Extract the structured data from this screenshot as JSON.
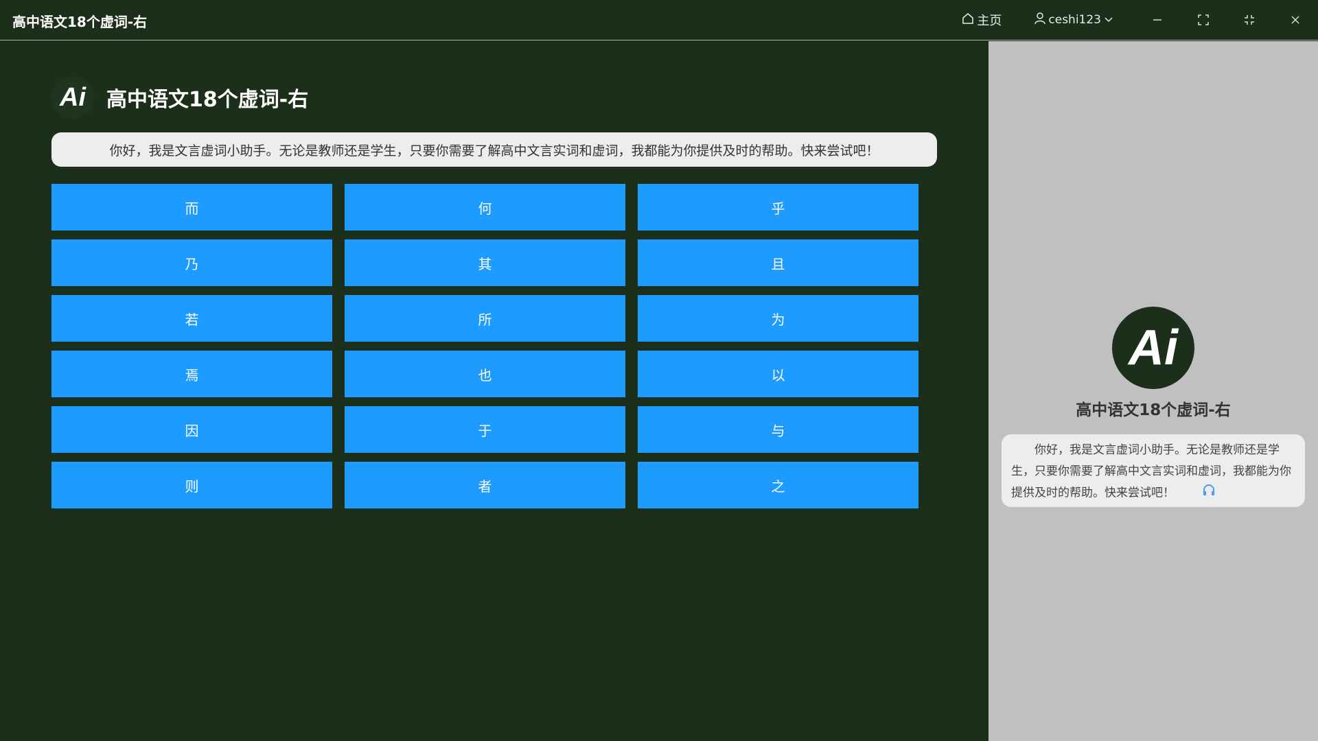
{
  "window": {
    "title": "高中语文18个虚词-右",
    "home_label": "主页",
    "user_label": "ceshi123"
  },
  "main": {
    "logo_text": "Ai",
    "title": "高中语文18个虚词-右",
    "intro": "你好，我是文言虚词小助手。无论是教师还是学生，只要你需要了解高中文言实词和虚词，我都能为你提供及时的帮助。快来尝试吧！",
    "words": [
      "而",
      "何",
      "乎",
      "乃",
      "其",
      "且",
      "若",
      "所",
      "为",
      "焉",
      "也",
      "以",
      "因",
      "于",
      "与",
      "则",
      "者",
      "之"
    ]
  },
  "side": {
    "logo_text": "Ai",
    "title": "高中语文18个虚词-右",
    "message": "你好，我是文言虚词小助手。无论是教师还是学生，只要你需要了解高中文言实词和虚词，我都能为你提供及时的帮助。快来尝试吧！"
  },
  "colors": {
    "background": "#1c2f1b",
    "button": "#1d9bff",
    "side_panel": "#c0c0c0",
    "bubble": "#ecedec"
  }
}
